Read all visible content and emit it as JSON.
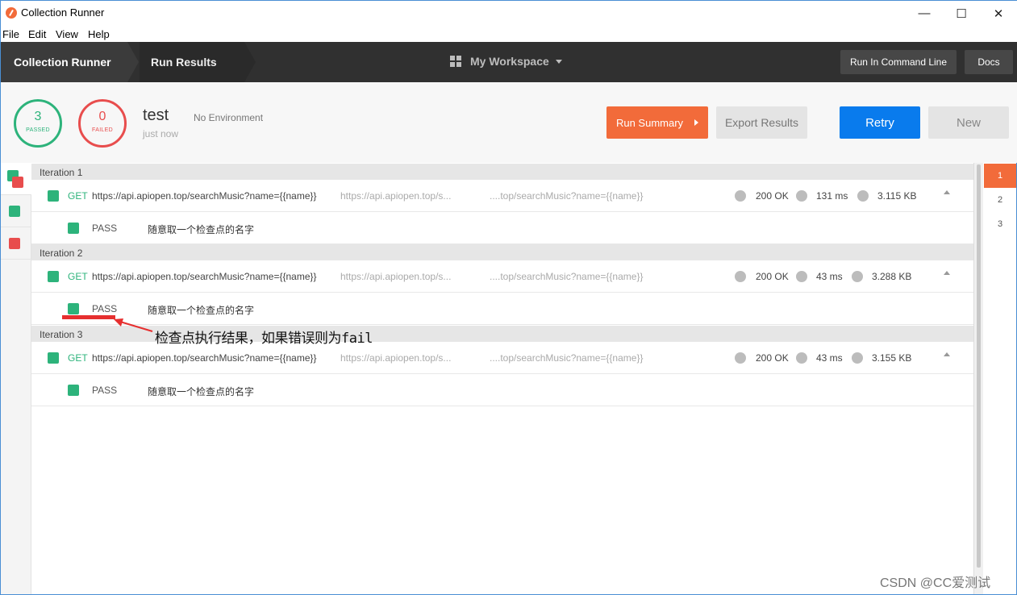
{
  "window": {
    "title": "Collection Runner",
    "controls": {
      "minimize": "—",
      "maximize": "☐",
      "close": "✕"
    }
  },
  "menu": [
    "File",
    "Edit",
    "View",
    "Help"
  ],
  "nav": {
    "crumbs": [
      "Collection Runner",
      "Run Results"
    ],
    "workspace": "My Workspace",
    "run_cli": "Run In Command Line",
    "docs": "Docs"
  },
  "summary": {
    "passed_count": "3",
    "passed_label": "PASSED",
    "failed_count": "0",
    "failed_label": "FAILED",
    "run_name": "test",
    "run_time": "just now",
    "environment": "No Environment",
    "run_summary_btn": "Run Summary",
    "export_btn": "Export Results",
    "retry_btn": "Retry",
    "new_btn": "New"
  },
  "iterations": [
    {
      "label": "Iteration 1",
      "method": "GET",
      "url": "https://api.apiopen.top/searchMusic?name={{name}}",
      "url_short": "https://api.apiopen.top/s...",
      "url_tail": "....top/searchMusic?name={{name}}",
      "status": "200 OK",
      "time": "131 ms",
      "size": "3.115 KB",
      "test_status": "PASS",
      "test_name": "随意取一个检查点的名字"
    },
    {
      "label": "Iteration 2",
      "method": "GET",
      "url": "https://api.apiopen.top/searchMusic?name={{name}}",
      "url_short": "https://api.apiopen.top/s...",
      "url_tail": "....top/searchMusic?name={{name}}",
      "status": "200 OK",
      "time": "43 ms",
      "size": "3.288 KB",
      "test_status": "PASS",
      "test_name": "随意取一个检查点的名字"
    },
    {
      "label": "Iteration 3",
      "method": "GET",
      "url": "https://api.apiopen.top/searchMusic?name={{name}}",
      "url_short": "https://api.apiopen.top/s...",
      "url_tail": "....top/searchMusic?name={{name}}",
      "status": "200 OK",
      "time": "43 ms",
      "size": "3.155 KB",
      "test_status": "PASS",
      "test_name": "随意取一个检查点的名字"
    }
  ],
  "iteration_nav": [
    "1",
    "2",
    "3"
  ],
  "annotation": "检查点执行结果，如果错误则为fail",
  "watermark": "CSDN @CC爱测试",
  "colors": {
    "pass": "#2db37b",
    "fail": "#e84d4d",
    "accent_orange": "#f26b3a",
    "accent_blue": "#097bed"
  }
}
